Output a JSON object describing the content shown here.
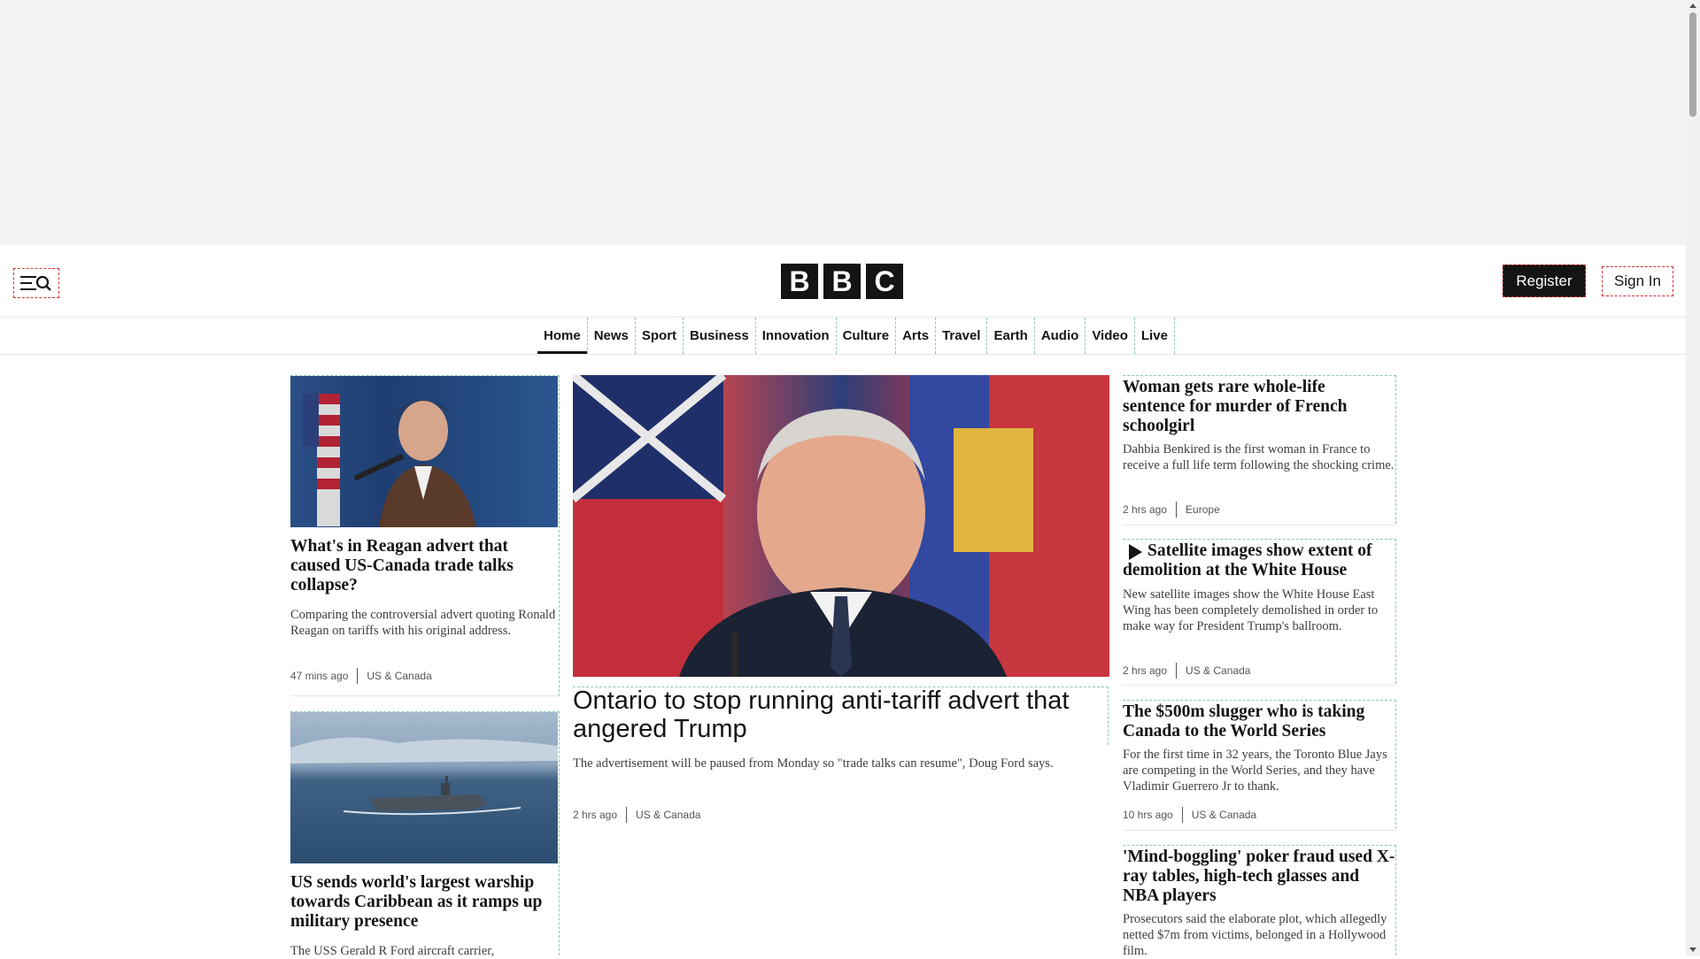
{
  "colors": {
    "brand": "#141414",
    "focus_dash": "#cc3333",
    "layout_dash": "#8fc7b0"
  },
  "header": {
    "logo_letters": [
      "B",
      "B",
      "C"
    ],
    "register_label": "Register",
    "signin_label": "Sign In",
    "menu_icon": "menu-search-icon"
  },
  "nav": {
    "items": [
      "Home",
      "News",
      "Sport",
      "Business",
      "Innovation",
      "Culture",
      "Arts",
      "Travel",
      "Earth",
      "Audio",
      "Video",
      "Live"
    ],
    "active": "Home"
  },
  "stories": {
    "reagan": {
      "headline": "What's in Reagan advert that caused US-Canada trade talks collapse?",
      "summary": "Comparing the controversial advert quoting Ronald Reagan on tariffs with his original address.",
      "time": "47 mins ago",
      "section": "US & Canada"
    },
    "warship": {
      "headline": "US sends world's largest warship towards Caribbean as it ramps up military presence",
      "summary": "The USS Gerald R Ford aircraft carrier,"
    },
    "ontario": {
      "headline": "Ontario to stop running anti-tariff advert that angered Trump",
      "summary": "The advertisement will be paused from Monday so \"trade talks can resume\", Doug Ford says.",
      "time": "2 hrs ago",
      "section": "US & Canada"
    },
    "france": {
      "headline": "Woman gets rare whole-life sentence for murder of French schoolgirl",
      "summary": "Dahbia Benkired is the first woman in France to receive a full life term following the shocking crime.",
      "time": "2 hrs ago",
      "section": "Europe"
    },
    "whitehouse": {
      "headline": "Satellite images show extent of demolition at the White House",
      "summary": "New satellite images show the White House East Wing has been completely demolished in order to make way for President Trump's ballroom.",
      "time": "2 hrs ago",
      "section": "US & Canada"
    },
    "slugger": {
      "headline": "The $500m slugger who is taking Canada to the World Series",
      "summary": "For the first time in 32 years, the Toronto Blue Jays are competing in the World Series, and they have Vladimir Guerrero Jr to thank.",
      "time": "10 hrs ago",
      "section": "US & Canada"
    },
    "poker": {
      "headline": "'Mind-boggling' poker fraud used X-ray tables, high-tech glasses and NBA players",
      "summary": "Prosecutors said the elaborate plot, which allegedly netted $7m from victims, belonged in a Hollywood film."
    }
  }
}
